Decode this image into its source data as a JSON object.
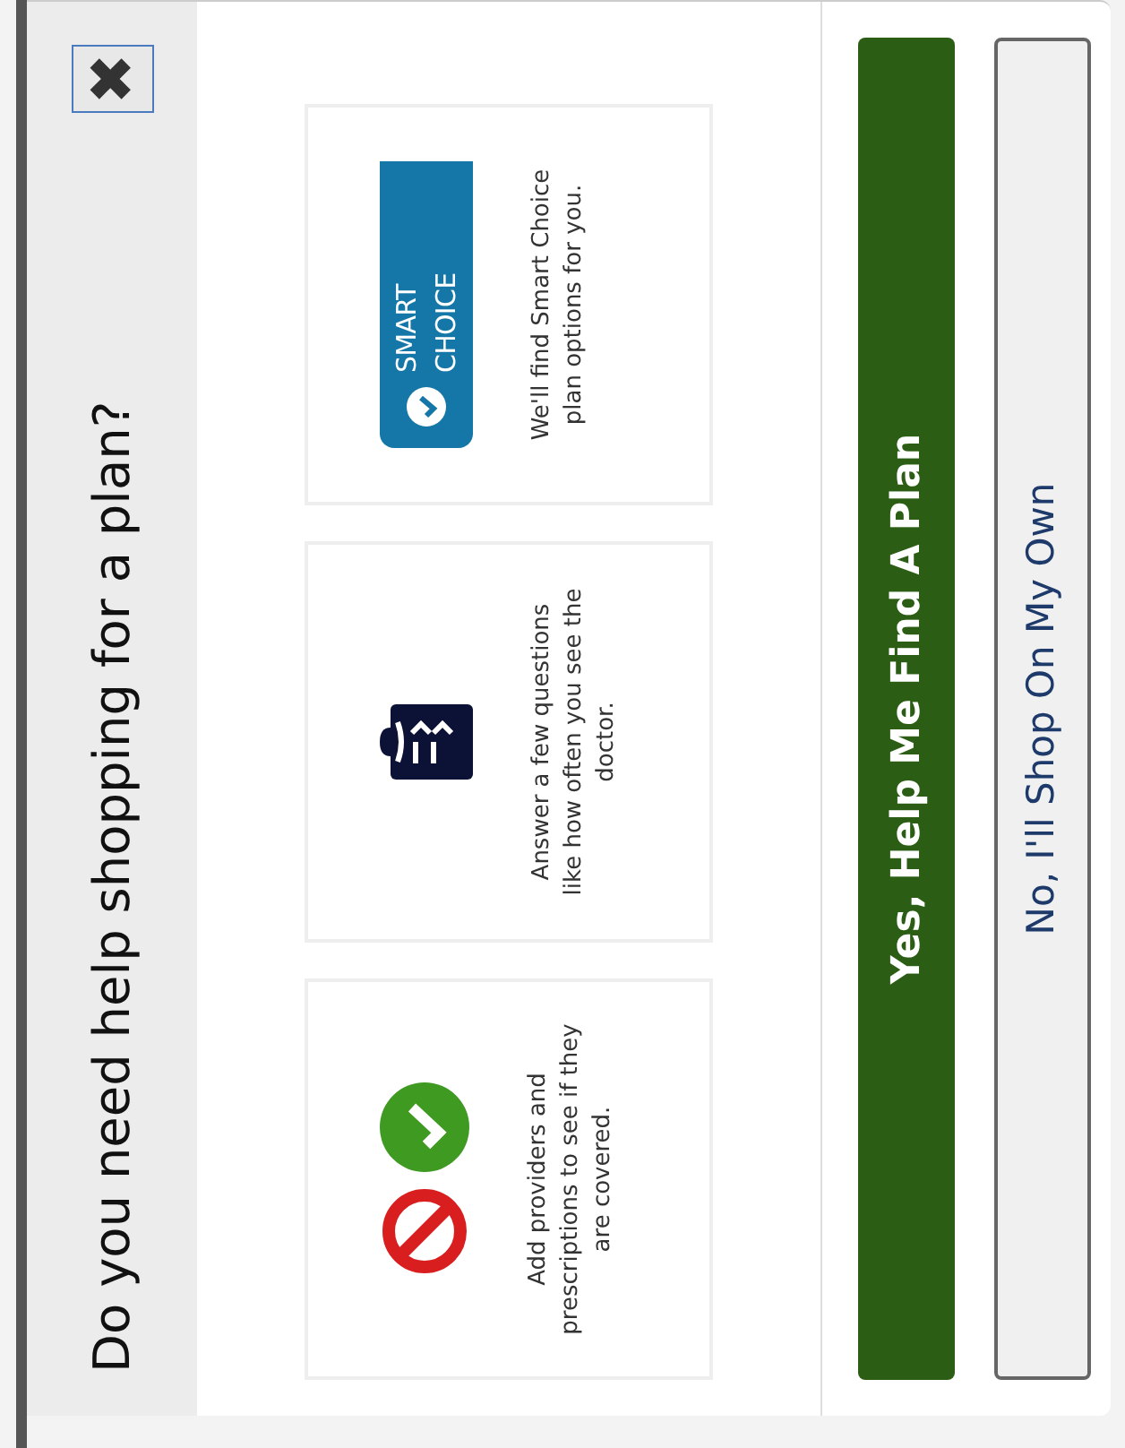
{
  "dialog": {
    "title": "Do you need help shopping for a plan?",
    "close_label": "✖",
    "steps": [
      {
        "kind": "coverage",
        "text": "Add providers and prescriptions to see if they are covered."
      },
      {
        "kind": "questions",
        "text": "Answer a few questions like how often you see the doctor."
      },
      {
        "kind": "badge",
        "badge": "SMART CHOICE",
        "text": "We'll find Smart Choice plan options for you."
      }
    ],
    "buttons": [
      {
        "label": "Yes, Help Me Find A Plan",
        "kind": "primary"
      },
      {
        "label": "No, I'll Shop On My Own",
        "kind": "secondary"
      }
    ]
  }
}
